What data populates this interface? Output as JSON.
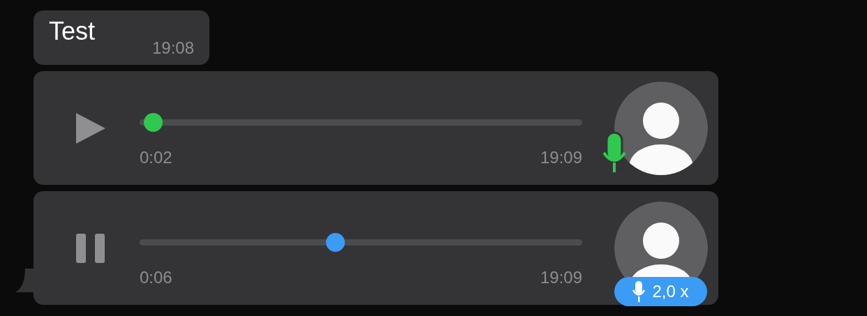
{
  "messages": [
    {
      "kind": "text",
      "text": "Test",
      "time": "19:08"
    },
    {
      "kind": "voice",
      "playing": false,
      "level": 0.01,
      "color": "#30c94f",
      "elapsed": "0:02",
      "time": "19:09",
      "tail": false
    },
    {
      "kind": "voice",
      "playing": true,
      "level": 0.44,
      "color": "#3a9cf5",
      "elapsed": "0:06",
      "time": "19:09",
      "speed": "2,0 x",
      "tail": true
    }
  ]
}
